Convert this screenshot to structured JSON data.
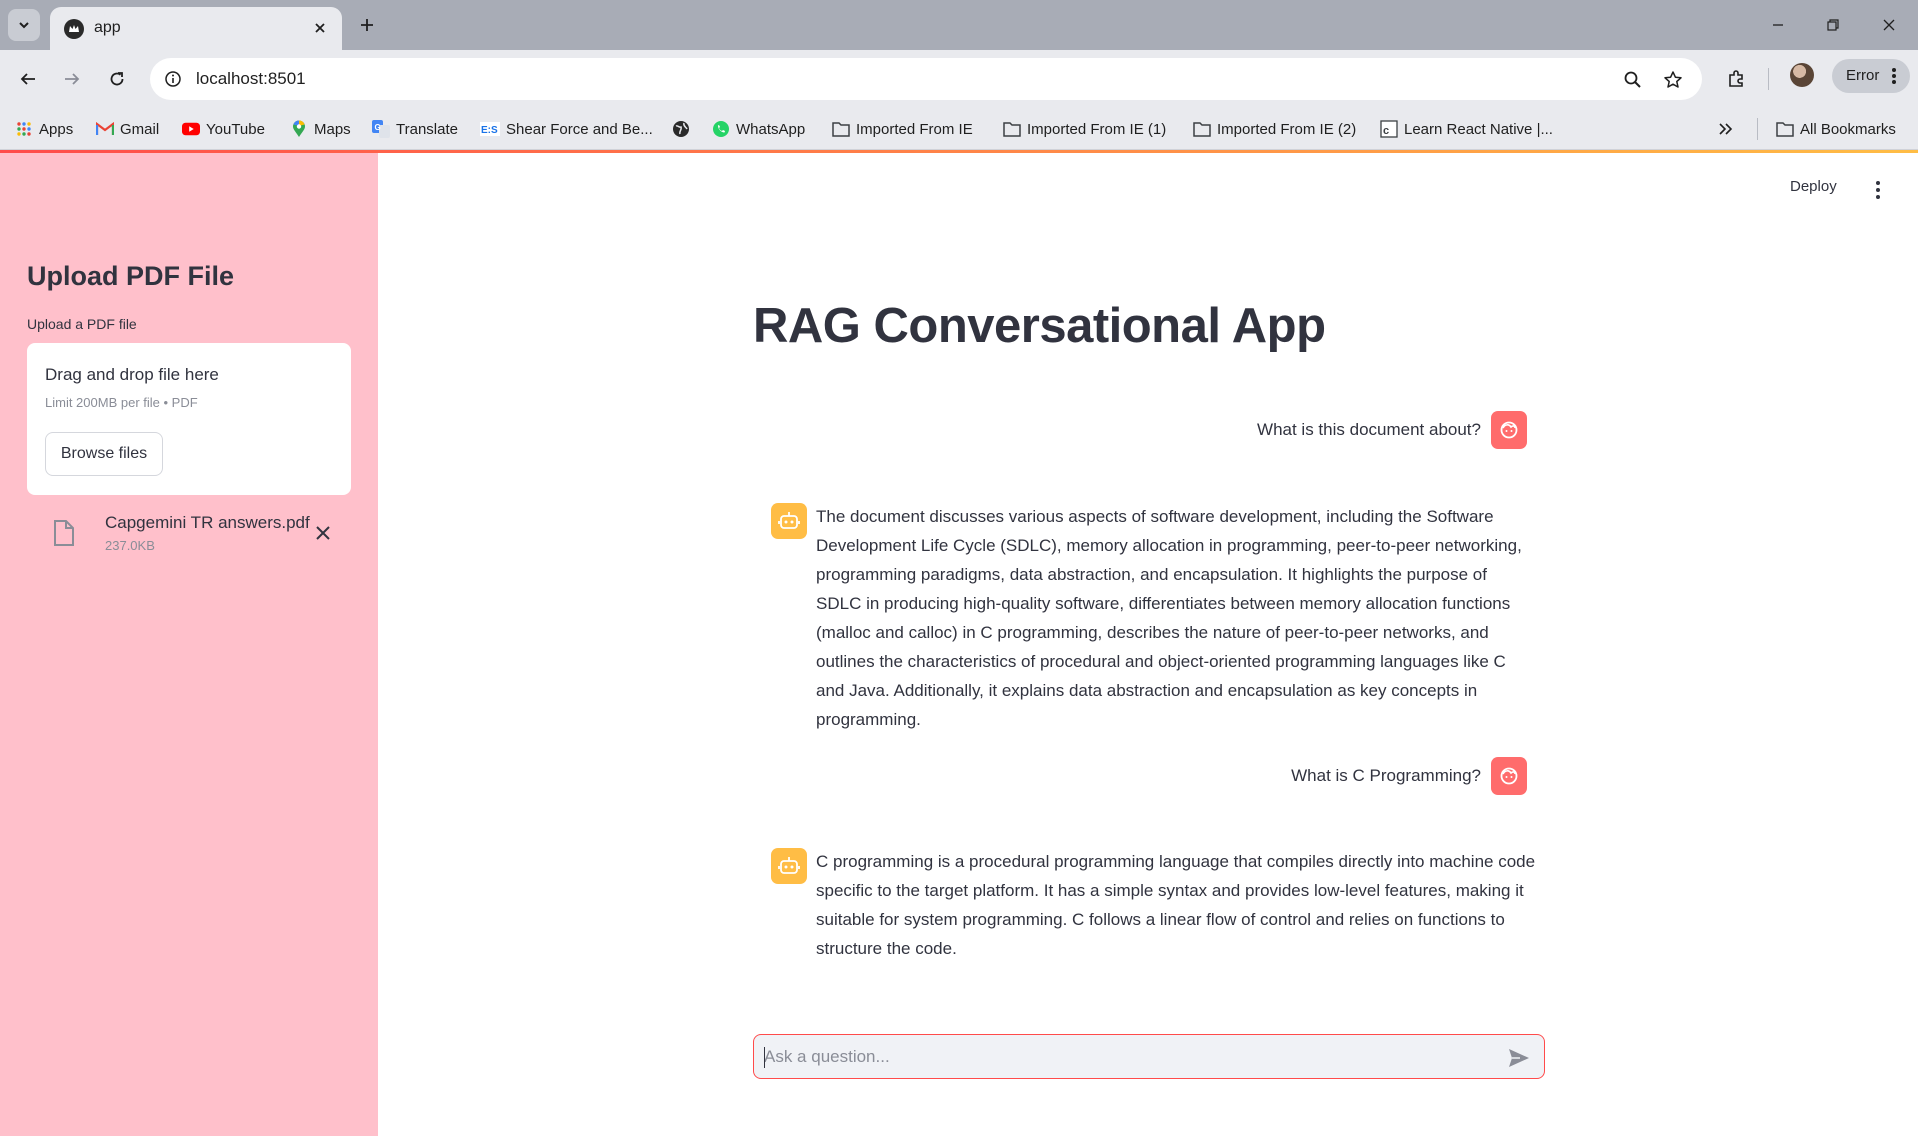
{
  "browser": {
    "tab_title": "app",
    "url": "localhost:8501",
    "profile_status": "Error",
    "bookmarks": [
      {
        "label": "Apps",
        "icon": "apps-grid-icon"
      },
      {
        "label": "Gmail",
        "icon": "gmail-icon"
      },
      {
        "label": "YouTube",
        "icon": "youtube-icon"
      },
      {
        "label": "Maps",
        "icon": "maps-pin-icon"
      },
      {
        "label": "Translate",
        "icon": "translate-icon"
      },
      {
        "label": "Shear Force and Be...",
        "icon": "es-icon"
      },
      {
        "label": "",
        "icon": "globe-icon"
      },
      {
        "label": "WhatsApp",
        "icon": "whatsapp-icon"
      },
      {
        "label": "Imported From IE",
        "icon": "folder-icon"
      },
      {
        "label": "Imported From IE (1)",
        "icon": "folder-icon"
      },
      {
        "label": "Imported From IE (2)",
        "icon": "folder-icon"
      },
      {
        "label": "Learn React Native |...",
        "icon": "bookmark-page-icon"
      }
    ],
    "all_bookmarks": "All Bookmarks"
  },
  "sidebar": {
    "title": "Upload PDF File",
    "uploader_label": "Upload a PDF file",
    "drop_text": "Drag and drop file here",
    "limit_text": "Limit 200MB per file • PDF",
    "browse_label": "Browse files",
    "file": {
      "name": "Capgemini TR answers.pdf",
      "size": "237.0KB"
    }
  },
  "header": {
    "deploy_label": "Deploy"
  },
  "main": {
    "title": "RAG Conversational App",
    "messages": [
      {
        "role": "user",
        "text": "What is this document about?"
      },
      {
        "role": "assistant",
        "text": "The document discusses various aspects of software development, including the Software Development Life Cycle (SDLC), memory allocation in programming, peer-to-peer networking, programming paradigms, data abstraction, and encapsulation. It highlights the purpose of SDLC in producing high-quality software, differentiates between memory allocation functions (malloc and calloc) in C programming, describes the nature of peer-to-peer networks, and outlines the characteristics of procedural and object-oriented programming languages like C and Java. Additionally, it explains data abstraction and encapsulation as key concepts in programming."
      },
      {
        "role": "user",
        "text": "What is C Programming?"
      },
      {
        "role": "assistant",
        "text": "C programming is a procedural programming language that compiles directly into machine code specific to the target platform. It has a simple syntax and provides low-level features, making it suitable for system programming. C follows a linear flow of control and relies on functions to structure the code."
      }
    ],
    "input_placeholder": "Ask a question..."
  },
  "colors": {
    "sidebar_bg": "#ffc0cb",
    "user_avatar": "#ff6c6c",
    "assistant_avatar": "#ffbd45",
    "accent": "#ff4b4b"
  }
}
